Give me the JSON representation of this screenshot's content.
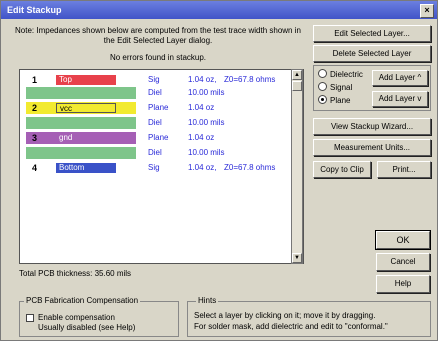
{
  "window": {
    "title": "Edit Stackup",
    "close_glyph": "×"
  },
  "note": "Note: Impedances shown below are computed from the test trace width shown in the Edit Selected Layer dialog.",
  "status": "No errors found in stackup.",
  "layers": [
    {
      "num": "1",
      "name": "Top",
      "name_color": "#e8414b",
      "type": "Sig",
      "thickness": "1.04 oz,",
      "impedance": "Z0=67.8 ohms"
    },
    {
      "num": "",
      "name": "",
      "type": "Diel",
      "thickness": "10.00 mils",
      "impedance": ""
    },
    {
      "num": "2",
      "name": "vcc",
      "name_color": "#f2ea30",
      "type": "Plane",
      "thickness": "1.04 oz",
      "impedance": ""
    },
    {
      "num": "",
      "name": "",
      "type": "Diel",
      "thickness": "10.00 mils",
      "impedance": ""
    },
    {
      "num": "3",
      "name": "gnd",
      "name_color": "#a55fb5",
      "type": "Plane",
      "thickness": "1.04 oz",
      "impedance": ""
    },
    {
      "num": "",
      "name": "",
      "type": "Diel",
      "thickness": "10.00 mils",
      "impedance": ""
    },
    {
      "num": "4",
      "name": "Bottom",
      "name_color": "#3a52c8",
      "type": "Sig",
      "thickness": "1.04 oz,",
      "impedance": "Z0=67.8 ohms"
    }
  ],
  "buttons": {
    "edit_layer": "Edit Selected Layer...",
    "delete_layer": "Delete Selected Layer",
    "add_layer_up": "Add Layer ^",
    "add_layer_down": "Add Layer v",
    "view_wizard": "View Stackup Wizard...",
    "measurement_units": "Measurement Units...",
    "copy_to_clip": "Copy to Clip",
    "print": "Print...",
    "ok": "OK",
    "cancel": "Cancel",
    "help": "Help"
  },
  "layer_kind": {
    "options": [
      "Dielectric",
      "Signal",
      "Plane"
    ],
    "selected": "Plane"
  },
  "total_thickness": "Total PCB thickness: 35.60 mils",
  "compensation": {
    "title": "PCB Fabrication Compensation",
    "checkbox_label": "Enable compensation",
    "checked": false,
    "note": "Usually disabled (see Help)"
  },
  "hints": {
    "title": "Hints",
    "line1": "Select a layer by clicking on it; move it by dragging.",
    "line2": "For solder mask, add dielectric and edit to \"conformal.\""
  },
  "colors": {
    "dielectric_band": "#7ec58a",
    "value_text": "#2a2ad8",
    "title_bar": "#4f62d6"
  }
}
